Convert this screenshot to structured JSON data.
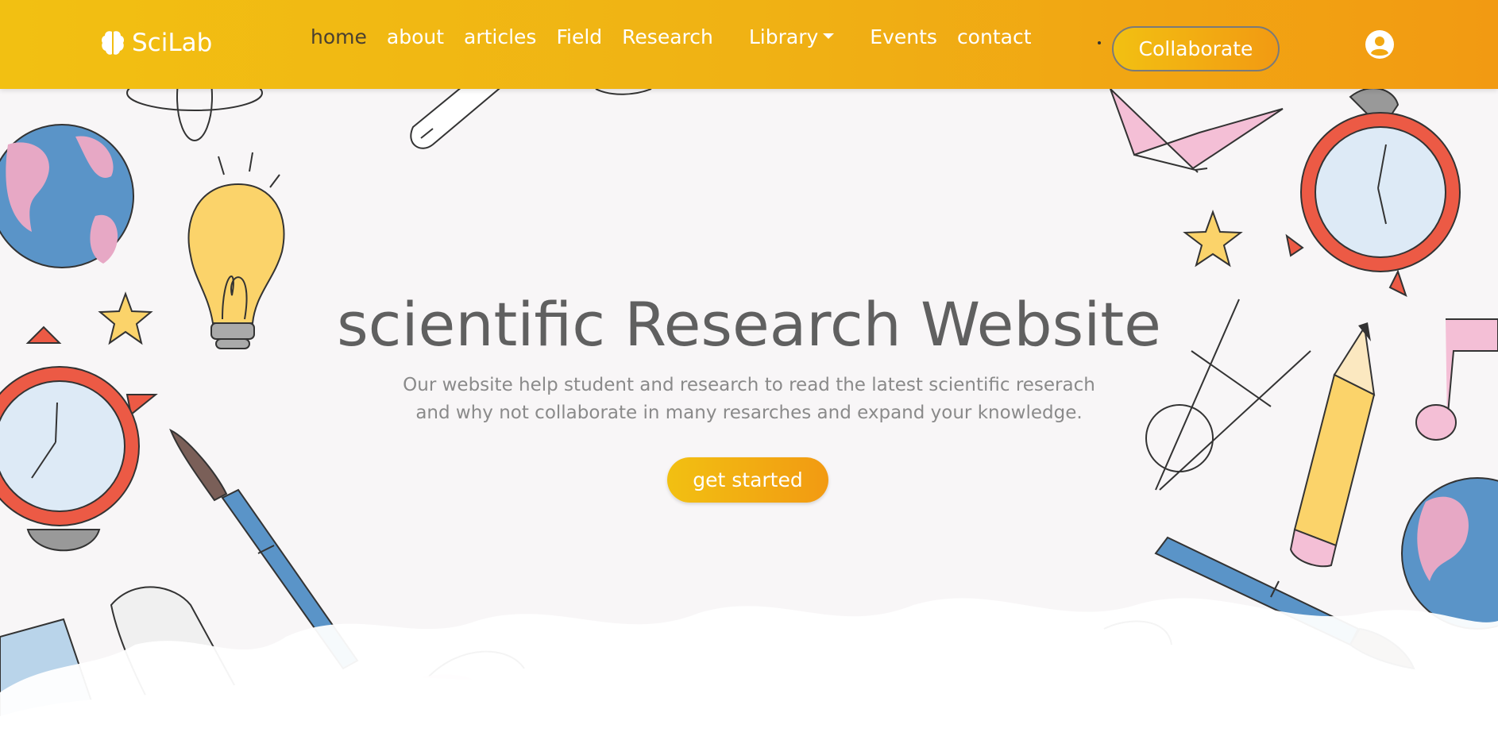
{
  "brand": {
    "name": "SciLab",
    "icon": "brain-icon"
  },
  "nav": {
    "items": [
      {
        "label": "home",
        "active": true
      },
      {
        "label": "about"
      },
      {
        "label": "articles"
      },
      {
        "label": "Field"
      },
      {
        "label": "Research"
      },
      {
        "label": "Library",
        "dropdown": true
      },
      {
        "label": "Events"
      },
      {
        "label": "contact"
      }
    ],
    "collaborate_label": "Collaborate",
    "user_icon": "user-circle-icon"
  },
  "hero": {
    "title": "scientific Research Website",
    "subtitle_line1": "Our website help student and research to read the latest scientific reserach",
    "subtitle_line2": "and why not collaborate in many resarches and expand your knowledge.",
    "cta_label": "get started"
  },
  "colors": {
    "accent_start": "#f2c012",
    "accent_end": "#f29a12",
    "title": "#606060",
    "subtitle": "#8a8a8a",
    "background": "#f8f6f7"
  }
}
